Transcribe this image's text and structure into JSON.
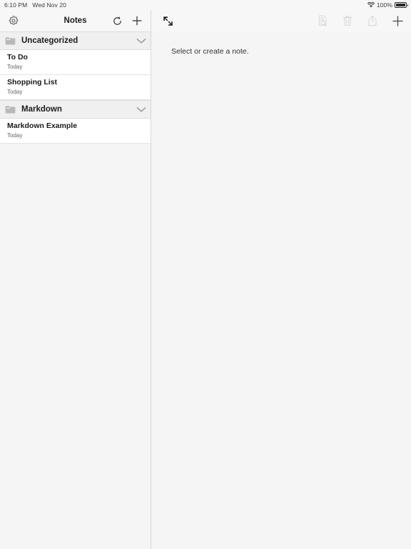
{
  "statusbar": {
    "time": "6:10 PM",
    "date": "Wed Nov 20",
    "wifi_icon": "wifi-icon",
    "battery_percent": "100%",
    "battery_icon": "battery-icon"
  },
  "sidebar": {
    "title": "Notes",
    "settings_icon": "gear-icon",
    "refresh_icon": "refresh-icon",
    "add_icon": "plus-icon",
    "sections": [
      {
        "folder": "Uncategorized",
        "folder_icon": "folder-icon",
        "chevron_icon": "chevron-down-icon",
        "notes": [
          {
            "title": "To Do",
            "date": "Today"
          },
          {
            "title": "Shopping List",
            "date": "Today"
          }
        ]
      },
      {
        "folder": "Markdown",
        "folder_icon": "folder-icon",
        "chevron_icon": "chevron-down-icon",
        "notes": [
          {
            "title": "Markdown Example",
            "date": "Today"
          }
        ]
      }
    ]
  },
  "detail": {
    "expand_icon": "expand-arrows-icon",
    "find_icon": "find-in-note-icon",
    "delete_icon": "trash-icon",
    "share_icon": "share-icon",
    "add_icon": "plus-icon",
    "placeholder": "Select or create a note."
  },
  "colors": {
    "chrome": "#f7f7f7",
    "canvas": "#f5f5f5",
    "list_bg": "#ffffff",
    "folder_bg": "#f0f0f0",
    "divider": "#d8d8d8",
    "text_primary": "#1c1c1c",
    "text_secondary": "#666666",
    "icon_enabled": "#3a3a3a",
    "icon_disabled": "#d2d2d2"
  }
}
